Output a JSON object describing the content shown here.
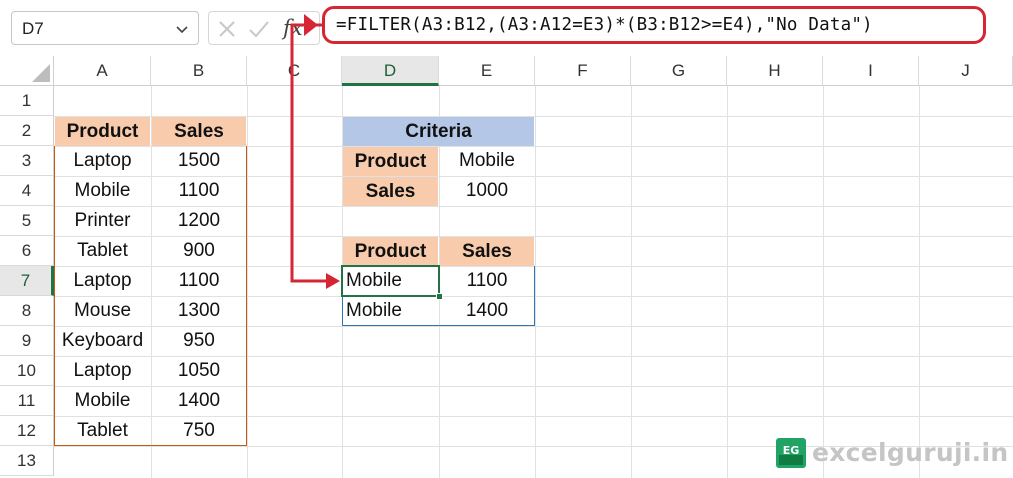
{
  "name_box": {
    "value": "D7"
  },
  "formula_bar": {
    "fx_label": "fx",
    "formula": "=FILTER(A3:B12,(A3:A12=E3)*(B3:B12>=E4),\"No Data\")"
  },
  "columns": [
    "A",
    "B",
    "C",
    "D",
    "E",
    "F",
    "G",
    "H",
    "I",
    "J"
  ],
  "selected_column": "D",
  "rows": [
    "1",
    "2",
    "3",
    "4",
    "5",
    "6",
    "7",
    "8",
    "9",
    "10",
    "11",
    "12",
    "13"
  ],
  "selected_row": "7",
  "source_table": {
    "headers": [
      "Product",
      "Sales"
    ],
    "rows": [
      [
        "Laptop",
        "1500"
      ],
      [
        "Mobile",
        "1100"
      ],
      [
        "Printer",
        "1200"
      ],
      [
        "Tablet",
        "900"
      ],
      [
        "Laptop",
        "1100"
      ],
      [
        "Mouse",
        "1300"
      ],
      [
        "Keyboard",
        "950"
      ],
      [
        "Laptop",
        "1050"
      ],
      [
        "Mobile",
        "1400"
      ],
      [
        "Tablet",
        "750"
      ]
    ]
  },
  "criteria": {
    "title": "Criteria",
    "product_label": "Product",
    "product_value": "Mobile",
    "sales_label": "Sales",
    "sales_value": "1000"
  },
  "result_table": {
    "headers": [
      "Product",
      "Sales"
    ],
    "rows": [
      [
        "Mobile",
        "1100"
      ],
      [
        "Mobile",
        "1400"
      ]
    ]
  },
  "watermark": {
    "text": "excelguruji.in",
    "logo_text": "EG"
  },
  "colors": {
    "header_fill": "#f8cbad",
    "criteria_fill": "#b4c7e7",
    "highlight_red": "#d62633",
    "selection_green": "#217346"
  }
}
